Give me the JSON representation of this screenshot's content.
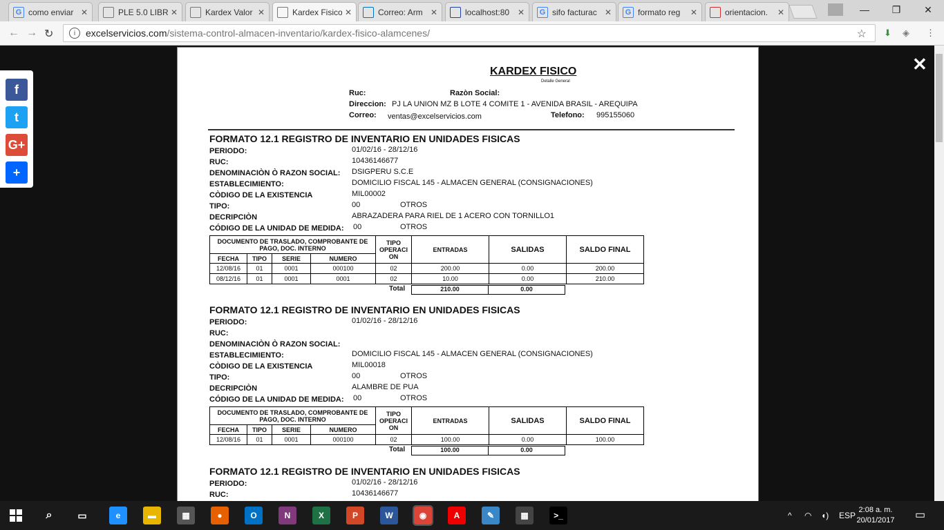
{
  "browser": {
    "tabs": [
      {
        "title": "como enviar",
        "icon": "google-icon",
        "color": "#4285f4"
      },
      {
        "title": "PLE 5.0 LIBR",
        "icon": "page-icon",
        "color": "#777"
      },
      {
        "title": "Kardex Valor",
        "icon": "page-icon",
        "color": "#777"
      },
      {
        "title": "Kardex Fisico",
        "icon": "page-icon",
        "color": "#777"
      },
      {
        "title": "Correo: Arm",
        "icon": "outlook-icon",
        "color": "#0072c6"
      },
      {
        "title": "localhost:80",
        "icon": "phpmyadmin-icon",
        "color": "#1e40a8"
      },
      {
        "title": "sifo facturac",
        "icon": "google-icon",
        "color": "#4285f4"
      },
      {
        "title": "formato reg",
        "icon": "google-icon",
        "color": "#4285f4"
      },
      {
        "title": "orientacion.",
        "icon": "sunat-icon",
        "color": "#d32f2f"
      }
    ],
    "url_host": "excelservicios.com",
    "url_path": "/sistema-control-almacen-inventario/kardex-fisico-alamcenes/"
  },
  "document": {
    "title": "KARDEX FISICO",
    "subtitle": "Detalle General",
    "header": {
      "ruc_label": "Ruc:",
      "ruc_value": "",
      "razon_label": "Razòn Social:",
      "razon_value": "",
      "direccion_label": "Direccion:",
      "direccion_value": "PJ LA UNION MZ B LOTE 4 COMITE 1 - AVENIDA BRASIL -  AREQUIPA",
      "correo_label": "Correo:",
      "correo_value": "ventas@excelservicios.com",
      "telefono_label": "Telefono:",
      "telefono_value": "995155060"
    },
    "labels": {
      "periodo": "PERIODO:",
      "ruc": "RUC:",
      "denominacion": "DENOMINACIÒN Ò RAZON SOCIAL:",
      "establecimiento": "ESTABLECIMIENTO:",
      "codigo": "CÒDIGO DE LA EXISTENCIA",
      "tipo": "TIPO:",
      "descripcion": "DECRIPCIÒN",
      "unidad": "CÓDIGO DE LA UNIDAD DE MEDIDA:"
    },
    "table_headers": {
      "doc": "DOCUMENTO DE TRASLADO, COMPROBANTE DE PAGO, DOC. INTERNO",
      "tipo_op": "TIPO OPERACI ON",
      "entradas": "ENTRADAS",
      "salidas": "SALIDAS",
      "saldo": "SALDO FINAL",
      "fecha": "FECHA",
      "tipo": "TIPO",
      "serie": "SERIE",
      "numero": "NUMERO",
      "total": "Total"
    },
    "sections": [
      {
        "title": "FORMATO 12.1 REGISTRO DE INVENTARIO EN UNIDADES FISICAS",
        "periodo": "01/02/16 - 28/12/16",
        "ruc": "10436146677",
        "denominacion": "DSIGPERU S.C.E",
        "establecimiento": "DOMICILIO FISCAL 145 - ALMACEN GENERAL (CONSIGNACIONES)",
        "codigo": "MIL00002",
        "tipo_code": "00",
        "tipo_name": "OTROS",
        "descripcion": "ABRAZADERA PARA  RIEL DE 1 ACERO CON TORNILLO1",
        "unidad_code": "00",
        "unidad_name": "OTROS",
        "rows": [
          {
            "fecha": "12/08/16",
            "tipo": "01",
            "serie": "0001",
            "numero": "000100",
            "tipo_op": "02",
            "entradas": "200.00",
            "salidas": "0.00",
            "saldo": "200.00"
          },
          {
            "fecha": "08/12/16",
            "tipo": "01",
            "serie": "0001",
            "numero": "0001",
            "tipo_op": "02",
            "entradas": "10.00",
            "salidas": "0.00",
            "saldo": "210.00"
          }
        ],
        "total_entradas": "210.00",
        "total_salidas": "0.00"
      },
      {
        "title": "FORMATO 12.1 REGISTRO DE INVENTARIO EN UNIDADES FISICAS",
        "periodo": "01/02/16 - 28/12/16",
        "ruc": "",
        "denominacion": "",
        "establecimiento": "DOMICILIO FISCAL 145 - ALMACEN GENERAL (CONSIGNACIONES)",
        "codigo": "MIL00018",
        "tipo_code": "00",
        "tipo_name": "OTROS",
        "descripcion": "ALAMBRE DE PUA",
        "unidad_code": "00",
        "unidad_name": "OTROS",
        "rows": [
          {
            "fecha": "12/08/16",
            "tipo": "01",
            "serie": "0001",
            "numero": "000100",
            "tipo_op": "02",
            "entradas": "100.00",
            "salidas": "0.00",
            "saldo": "100.00"
          }
        ],
        "total_entradas": "100.00",
        "total_salidas": "0.00"
      },
      {
        "title": "FORMATO 12.1 REGISTRO DE INVENTARIO EN UNIDADES FISICAS",
        "periodo": "01/02/16 - 28/12/16",
        "ruc": "10436146677"
      }
    ]
  },
  "share": [
    {
      "name": "facebook-icon",
      "glyph": "f",
      "color": "#3b5998"
    },
    {
      "name": "twitter-icon",
      "glyph": "t",
      "color": "#1da1f2"
    },
    {
      "name": "google-plus-icon",
      "glyph": "G+",
      "color": "#dd4b39"
    },
    {
      "name": "share-plus-icon",
      "glyph": "+",
      "color": "#0166ff"
    }
  ],
  "taskbar": {
    "apps": [
      {
        "name": "edge-icon",
        "glyph": "e",
        "color": "#1e90ff"
      },
      {
        "name": "file-explorer-icon",
        "glyph": "▬",
        "color": "#e8b600"
      },
      {
        "name": "store-icon",
        "glyph": "▦",
        "color": "#555"
      },
      {
        "name": "firefox-icon",
        "glyph": "●",
        "color": "#e66000"
      },
      {
        "name": "outlook-icon",
        "glyph": "O",
        "color": "#0072c6"
      },
      {
        "name": "onenote-icon",
        "glyph": "N",
        "color": "#80397b"
      },
      {
        "name": "excel-icon",
        "glyph": "X",
        "color": "#1e7145"
      },
      {
        "name": "powerpoint-icon",
        "glyph": "P",
        "color": "#d24726"
      },
      {
        "name": "word-icon",
        "glyph": "W",
        "color": "#2b579a"
      },
      {
        "name": "chrome-icon",
        "glyph": "◉",
        "color": "#db4437"
      },
      {
        "name": "acrobat-icon",
        "glyph": "A",
        "color": "#e00"
      },
      {
        "name": "notes-icon",
        "glyph": "✎",
        "color": "#3a87c8"
      },
      {
        "name": "calculator-icon",
        "glyph": "▦",
        "color": "#444"
      },
      {
        "name": "cmd-icon",
        "glyph": ">_",
        "color": "#000"
      }
    ],
    "language": "ESP",
    "time": "2:08 a. m.",
    "date": "20/01/2017"
  }
}
